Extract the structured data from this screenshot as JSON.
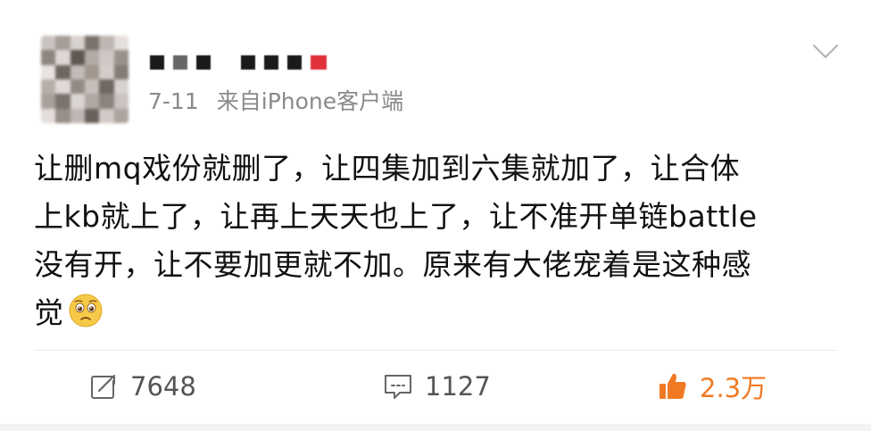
{
  "post": {
    "avatar_colors": [
      "#c9c3c0",
      "#a69d99",
      "#d8d2cf",
      "#7a706c",
      "#bdb5b2",
      "#e6e0dd",
      "#8f8580",
      "#ddd7d4",
      "#5f5551",
      "#b3aaa6",
      "#cfc8c5",
      "#9a908c",
      "#e8e3e0",
      "#6f6561",
      "#c2bab7",
      "#a1978f",
      "#d3ccc9",
      "#857b77",
      "#b7aeaa",
      "#e0dad7",
      "#938985",
      "#c6bebb",
      "#706662",
      "#d9d3d0",
      "#a99f9b",
      "#7c726e",
      "#dcd6d3",
      "#b0a7a3",
      "#8c827e",
      "#cac3c0",
      "#e4deda",
      "#988e8a",
      "#bfb7b4",
      "#6a605c",
      "#d1cac7",
      "#ada4a0"
    ],
    "meta": {
      "time": "7-11",
      "source": "来自iPhone客户端"
    },
    "content_lines": [
      "让删mq戏份就删了，让四集加到六集就加了，让合体",
      "上kb就上了，让再上天天也上了，让不准开单链battle",
      "没有开，让不要加更就不加。原来有大佬宠着是这种感",
      "觉"
    ],
    "emoji": "sad-pleading-emoji",
    "actions": {
      "repost_count": "7648",
      "comment_count": "1127",
      "like_count": "2.3万"
    },
    "colors": {
      "meta_gray": "#8a8a8a",
      "like_orange": "#f07a24",
      "action_gray": "#555555"
    }
  }
}
